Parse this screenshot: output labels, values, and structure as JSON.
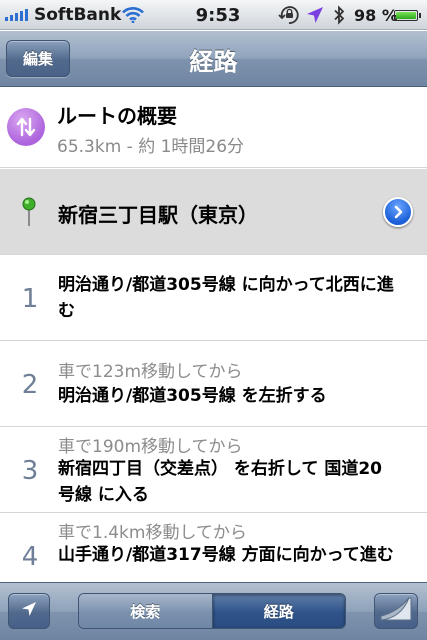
{
  "status_bar": {
    "carrier": "SoftBank",
    "time": "9:53",
    "battery_percent": "98 %",
    "battery_level": 0.98,
    "icons": [
      "signal-icon",
      "wifi-icon",
      "rotation-lock-icon",
      "location-arrow-icon",
      "bluetooth-icon",
      "battery-icon"
    ]
  },
  "nav_bar": {
    "edit_label": "編集",
    "title": "経路"
  },
  "summary": {
    "title": "ルートの概要",
    "subtitle": "65.3km - 約 1時間26分",
    "icon": "swap-arrows-icon",
    "icon_color": "#b06ade"
  },
  "start": {
    "label": "新宿三丁目駅（東京）",
    "pin_color": "#3fae2a",
    "detail_icon": "detail-disclosure-icon"
  },
  "steps": [
    {
      "number": "1",
      "pre": "",
      "text": "明治通り/都道305号線 に向かって北西に進む"
    },
    {
      "number": "2",
      "pre": "車で123m移動してから",
      "text": "明治通り/都道305号線 を左折する"
    },
    {
      "number": "3",
      "pre": "車で190m移動してから",
      "text": "新宿四丁目（交差点） を右折して 国道20号線 に入る"
    },
    {
      "number": "4",
      "pre": "車で1.4km移動してから",
      "text": "山手通り/都道317号線 方面に向かって進む"
    }
  ],
  "toolbar": {
    "search_label": "検索",
    "route_label": "経路",
    "selected": "経路",
    "locate_icon": "location-arrow-icon",
    "curl_icon": "page-curl-icon"
  }
}
